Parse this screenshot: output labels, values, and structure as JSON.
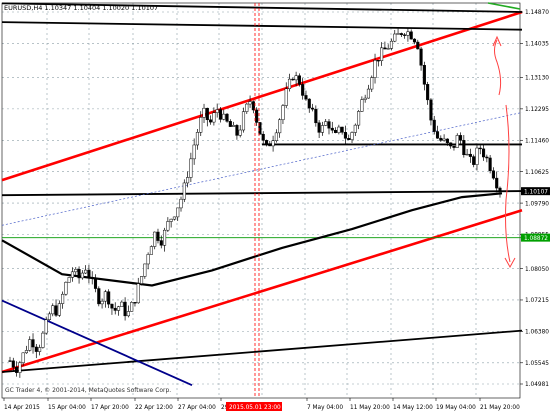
{
  "window": {
    "symbol_info": "EURUSD,H4 1.10347 1.10404 1.10020 1.10107",
    "copyright": "GC Trader 4, © 2001-2014, MetaQuotes Software Corp."
  },
  "price_axis": {
    "min": 1.04981,
    "max": 1.1487,
    "ticks": [
      "1.14870",
      "1.14035",
      "1.13130",
      "1.12295",
      "1.11460",
      "1.10625",
      "1.09790",
      "1.08955",
      "1.08050",
      "1.07215",
      "1.06380",
      "1.05545",
      "1.04981"
    ],
    "current_price_label": "1.10107",
    "current_price": 1.10107,
    "level_label": "1.08872",
    "level_price": 1.08872
  },
  "time_axis": {
    "labels": [
      "14 Apr 2015",
      "15 Apr 04:00",
      "17 Apr 20:00",
      "22 Apr 12:00",
      "27 Apr 04:00",
      "29 Apr 20:00",
      "7 May 04:00",
      "11 May 20:00",
      "14 May 12:00",
      "19 May 04:00",
      "21 May 20:00"
    ],
    "highlight_label": "2015.05.01 23:00"
  },
  "colors": {
    "background": "#ffffff",
    "grid": "#8ea0a8",
    "candle": "#000000",
    "bull_body": "#ffffff",
    "bear_body": "#000000",
    "ma_line": "#000000",
    "channel_red": "#ff0000",
    "channel_black": "#000000",
    "trend_blue": "#00008b",
    "dotted_blue": "#4a60c8",
    "level_green": "#009900",
    "price_tag_black": "#000000",
    "price_tag_green": "#00a000",
    "highlight_red": "#ff0000",
    "arrow_red": "#ff4040"
  },
  "chart_data": {
    "type": "candlestick",
    "symbol": "EURUSD",
    "timeframe": "H4",
    "ohlc_current": {
      "open": 1.10347,
      "high": 1.10404,
      "low": 1.1002,
      "close": 1.10107
    },
    "close_path": [
      1.056,
      1.054,
      1.058,
      1.062,
      1.059,
      1.064,
      1.07,
      1.069,
      1.076,
      1.08,
      1.078,
      1.081,
      1.076,
      1.072,
      1.074,
      1.069,
      1.071,
      1.068,
      1.072,
      1.078,
      1.085,
      1.09,
      1.088,
      1.093,
      1.096,
      1.1,
      1.108,
      1.116,
      1.122,
      1.119,
      1.123,
      1.12,
      1.118,
      1.116,
      1.122,
      1.126,
      1.118,
      1.112,
      1.115,
      1.12,
      1.127,
      1.132,
      1.13,
      1.124,
      1.121,
      1.117,
      1.12,
      1.115,
      1.118,
      1.114,
      1.119,
      1.125,
      1.13,
      1.136,
      1.138,
      1.14,
      1.142,
      1.144,
      1.143,
      1.141,
      1.13,
      1.12,
      1.115,
      1.114,
      1.112,
      1.116,
      1.111,
      1.108,
      1.113,
      1.11,
      1.106,
      1.101
    ],
    "moving_average": [
      [
        0,
        1.088
      ],
      [
        60,
        1.079
      ],
      [
        150,
        1.076
      ],
      [
        210,
        1.08
      ],
      [
        280,
        1.086
      ],
      [
        350,
        1.091
      ],
      [
        410,
        1.096
      ],
      [
        460,
        1.0995
      ],
      [
        500,
        1.1005
      ]
    ],
    "lines": [
      {
        "name": "channel-top-red",
        "color": "red",
        "from": [
          0,
          1.104
        ],
        "to": [
          520,
          1.1487
        ]
      },
      {
        "name": "channel-bottom-red",
        "color": "red",
        "from": [
          0,
          1.053
        ],
        "to": [
          520,
          1.096
        ]
      },
      {
        "name": "resistance-black-top",
        "color": "black",
        "from": [
          0,
          1.146
        ],
        "to": [
          520,
          1.144
        ]
      },
      {
        "name": "roof-black",
        "color": "black",
        "from": [
          0,
          1.151
        ],
        "to": [
          520,
          1.1487
        ]
      },
      {
        "name": "mid-black",
        "color": "black",
        "from": [
          260,
          1.1135
        ],
        "to": [
          520,
          1.1135
        ]
      },
      {
        "name": "current-black",
        "color": "black",
        "from": [
          0,
          1.1
        ],
        "to": [
          520,
          1.1011
        ]
      },
      {
        "name": "bottom-black",
        "color": "black",
        "from": [
          0,
          1.053
        ],
        "to": [
          520,
          1.064
        ]
      },
      {
        "name": "blue-downtrend",
        "color": "blue",
        "from": [
          0,
          1.072
        ],
        "to": [
          190,
          1.0495
        ]
      },
      {
        "name": "blue-dotted",
        "color": "blue",
        "from": [
          0,
          1.092
        ],
        "to": [
          520,
          1.122
        ]
      },
      {
        "name": "green-level",
        "color": "green",
        "from": [
          0,
          1.0887
        ],
        "to": [
          520,
          1.0887
        ]
      }
    ]
  }
}
